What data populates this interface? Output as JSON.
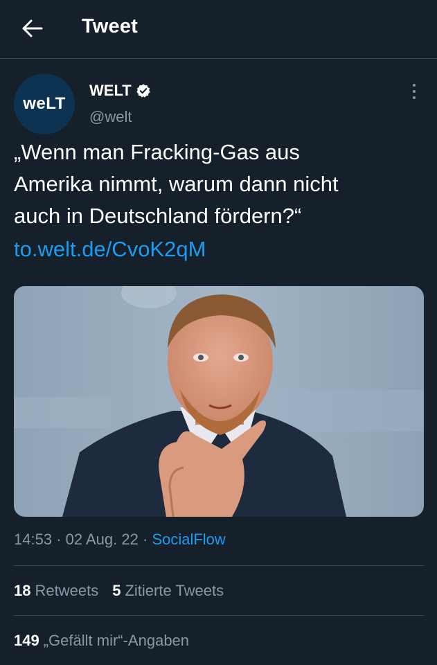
{
  "header": {
    "title": "Tweet"
  },
  "author": {
    "name": "WELT",
    "handle": "@welt",
    "avatar_text": "weLT"
  },
  "tweet": {
    "text_lines": [
      "„Wenn man Fracking-Gas aus",
      "Amerika nimmt, warum dann nicht",
      "auch in Deutschland fördern?“"
    ],
    "link": "to.welt.de/CvoK2qM",
    "time": "14:53",
    "date": "02 Aug. 22",
    "separator": "·",
    "source": "SocialFlow"
  },
  "stats": {
    "retweets_count": "18",
    "retweets_label": "Retweets",
    "quotes_count": "5",
    "quotes_label": "Zitierte Tweets",
    "likes_count": "149",
    "likes_label": "„Gefällt mir“-Angaben"
  },
  "colors": {
    "background": "#15202b",
    "accent": "#1d9bf0",
    "secondary_text": "#8899a6",
    "divider": "#38444d"
  }
}
